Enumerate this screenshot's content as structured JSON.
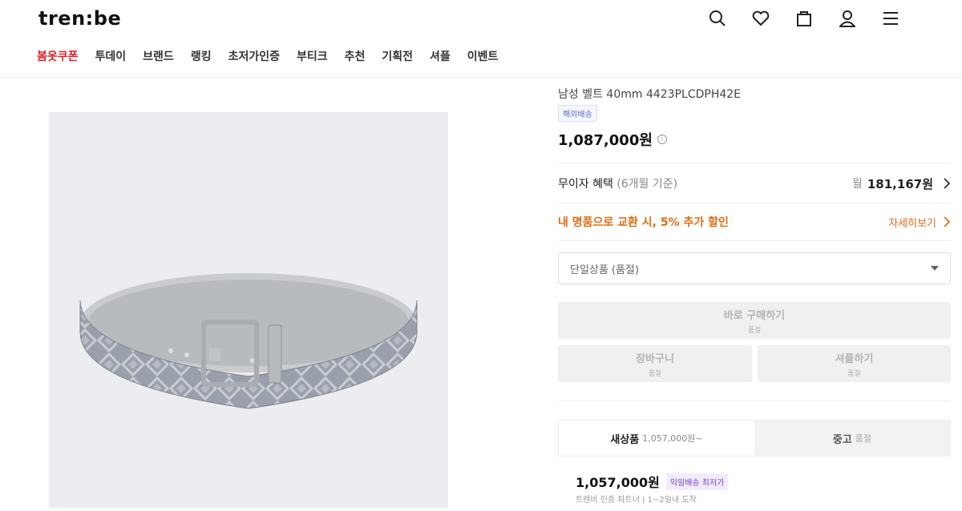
{
  "header": {
    "logo": "tren:be",
    "nav": [
      "봄옷쿠폰",
      "투데이",
      "브랜드",
      "랭킹",
      "초저가인증",
      "부티크",
      "추천",
      "기획전",
      "셔플",
      "이벤트"
    ]
  },
  "product": {
    "name": "남성 벨트 40mm 4423PLCDPH42E",
    "shipping_badge": "해외배송",
    "price": "1,087,000원",
    "installment_label": "무이자 혜택",
    "installment_note": "(6개월 기준)",
    "installment_prefix": "월",
    "installment_value": "181,167원",
    "trade_in_text": "내 명품으로 교환 시, 5% 추가 할인",
    "trade_in_link": "자세히보기",
    "option_select": "단일상품 (품절)",
    "buy_now": "바로 구매하기",
    "buy_now_sub": "품절",
    "cart": "장바구니",
    "cart_sub": "품절",
    "shuffle": "셔플하기",
    "shuffle_sub": "품절"
  },
  "tabs": {
    "new_label": "새상품",
    "new_price": "1,057,000원~",
    "used_label": "중고",
    "used_status": "품절"
  },
  "listing": {
    "price": "1,057,000원",
    "badge": "익일배송 최저가",
    "seller": "트렌비 인증 파트너  |  1~2일내 도착"
  },
  "colors": {
    "accent_red": "#e0202a",
    "orange": "#e26b12",
    "purple": "#7a3fd0"
  }
}
